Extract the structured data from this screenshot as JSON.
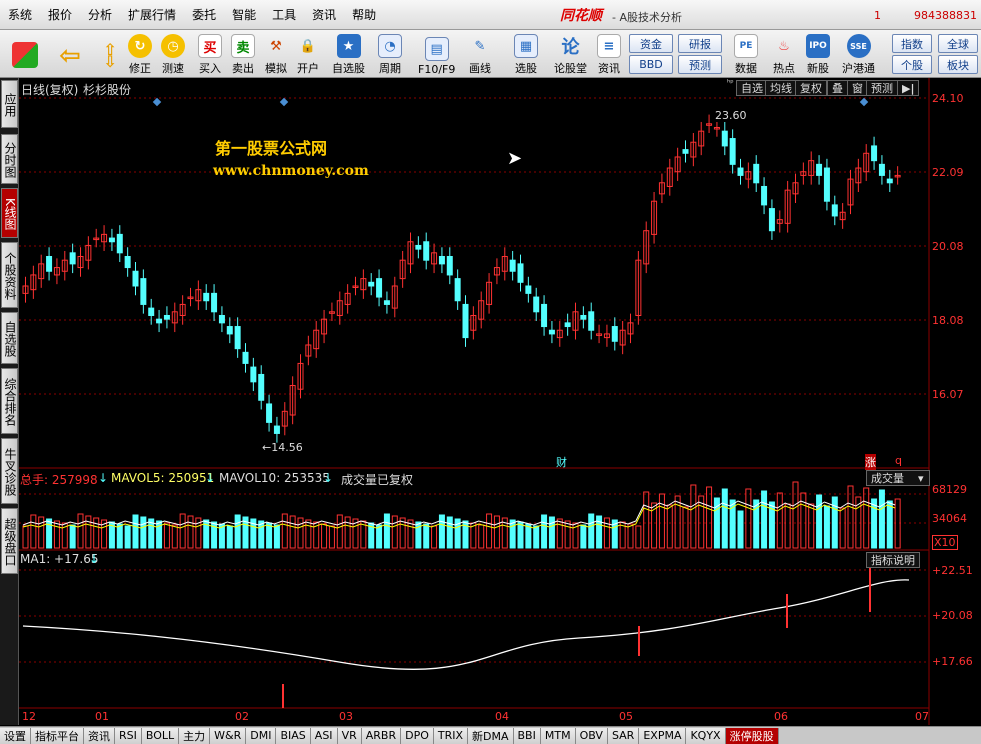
{
  "menu": {
    "items": [
      "系统",
      "报价",
      "分析",
      "扩展行情",
      "委托",
      "智能",
      "工具",
      "资讯",
      "帮助"
    ],
    "brand": "同花顺",
    "subtitle": "- A股技术分析",
    "num1": "1",
    "num2": "984388831"
  },
  "toolbar": {
    "buttons": [
      "修正",
      "测速",
      "买入",
      "卖出",
      "模拟",
      "开户",
      "自选股",
      "周期",
      "F10/F9",
      "画线",
      "选股",
      "论股堂",
      "资讯",
      "数据",
      "热点",
      "新股",
      "沪港通"
    ],
    "pills": [
      "资金",
      "研报",
      "BBD",
      "预测",
      "指数",
      "全球",
      "个股",
      "板块"
    ]
  },
  "sidebar": {
    "tabs": [
      "应用",
      "分时图",
      "K线图",
      "个股资料",
      "自选股",
      "综合排名",
      "牛叉诊股",
      "超级盘口"
    ],
    "active": "K线图"
  },
  "chart_header": {
    "period_label": "日线(复权)",
    "stock_name": "杉杉股份",
    "tabs": [
      "自选",
      "均线",
      "复权",
      "叠",
      "窗",
      "预测"
    ],
    "tabs_prefix": "ʰᵖ"
  },
  "watermark": {
    "line1": "第一股票公式网",
    "line2": "www.chnmoney.com"
  },
  "price_axis": [
    "24.10",
    "22.09",
    "20.08",
    "18.08",
    "16.07"
  ],
  "price_annotations": {
    "high": "23.60",
    "low": "←14.56"
  },
  "event_markers": {
    "cai": "财",
    "zhang": "涨",
    "q": "q"
  },
  "volume_panel": {
    "total": "总手: 257998",
    "mavol5": "MAVOL5: 250951",
    "mavol10": "MAVOL10: 253535",
    "note": "成交量已复权",
    "dropdown": "成交量",
    "axis": [
      "68129",
      "34064"
    ],
    "unit": "X10"
  },
  "ma_panel": {
    "label": "MA1: +17.65",
    "explain": "指标说明",
    "axis": [
      "+22.51",
      "+20.08",
      "+17.66"
    ]
  },
  "x_axis": [
    "12",
    "01",
    "02",
    "03",
    "04",
    "05",
    "06",
    "07"
  ],
  "bottom_tabs": [
    "设置",
    "指标平台",
    "资讯",
    "RSI",
    "BOLL",
    "主力",
    "W&R",
    "DMI",
    "BIAS",
    "ASI",
    "VR",
    "ARBR",
    "DPO",
    "TRIX",
    "新DMA",
    "BBI",
    "MTM",
    "OBV",
    "SAR",
    "EXPMA",
    "KQYX",
    "涨停股股"
  ],
  "bottom_active": "涨停股股",
  "colors": {
    "up": "#ff3232",
    "down": "#54ffff",
    "ma": "#ffffff",
    "mavol5": "#ffffff",
    "mavol10": "#ffff00",
    "grid": "#8b0000"
  }
}
